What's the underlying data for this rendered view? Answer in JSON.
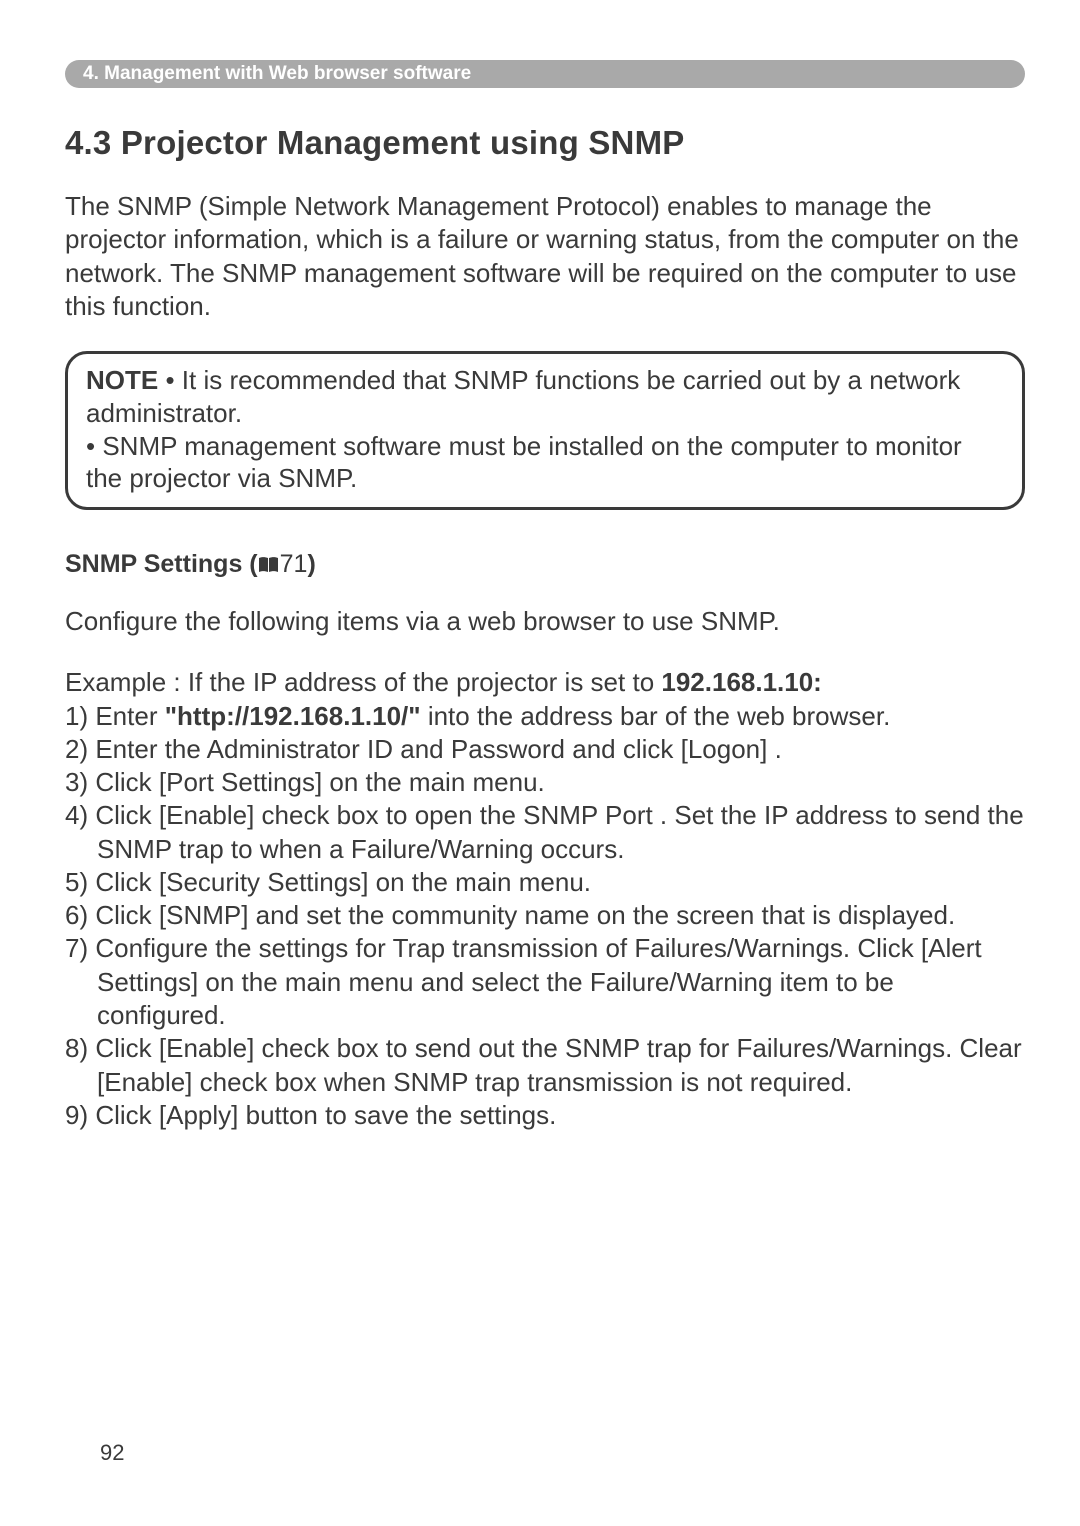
{
  "chapter_bar": "4. Management with Web browser software",
  "section_title": "4.3 Projector Management using SNMP",
  "intro": "The SNMP (Simple Network Management Protocol) enables to manage the projector information, which is a failure or warning status, from the computer on the network. The SNMP management software will be required on the computer to use this function.",
  "note": {
    "label": "NOTE",
    "bullet1": " • It is recommended that SNMP functions be carried out by a network administrator.",
    "bullet2": "• SNMP management software must be installed on the computer to monitor the projector via SNMP."
  },
  "subheading": {
    "prefix": "SNMP Settings (",
    "pageref": "71",
    "suffix": ")"
  },
  "config_line": "Configure the following items via a web browser to use SNMP.",
  "example": {
    "prefix": "Example : If the IP address of the projector is set to ",
    "ip_bold": "192.168.1.10:"
  },
  "steps": {
    "s1a": "1) Enter ",
    "s1b": "\"http://192.168.1.10/\"",
    "s1c": " into the address bar of the web browser.",
    "s2": "2) Enter the Administrator ID and Password and click [Logon]  .",
    "s3": "3) Click [Port Settings]   on the main menu.",
    "s4": "4) Click [Enable]  check box to open the SNMP Port . Set the IP address to send the SNMP trap to when a Failure/Warning occurs.",
    "s5": "5) Click [Security Settings]    on the main menu.",
    "s6": "6) Click [SNMP]  and set the community name on the screen that is displayed.",
    "s7": "7) Configure the settings for Trap transmission of Failures/Warnings. Click [Alert Settings]   on the main menu and select the Failure/Warning item to be configured.",
    "s8": "8) Click [Enable]  check box to send out the SNMP trap for Failures/Warnings. Clear [Enable]  check box when SNMP trap transmission is not required.",
    "s9": "9) Click [Apply]  button to save the settings."
  },
  "page_number": "92"
}
